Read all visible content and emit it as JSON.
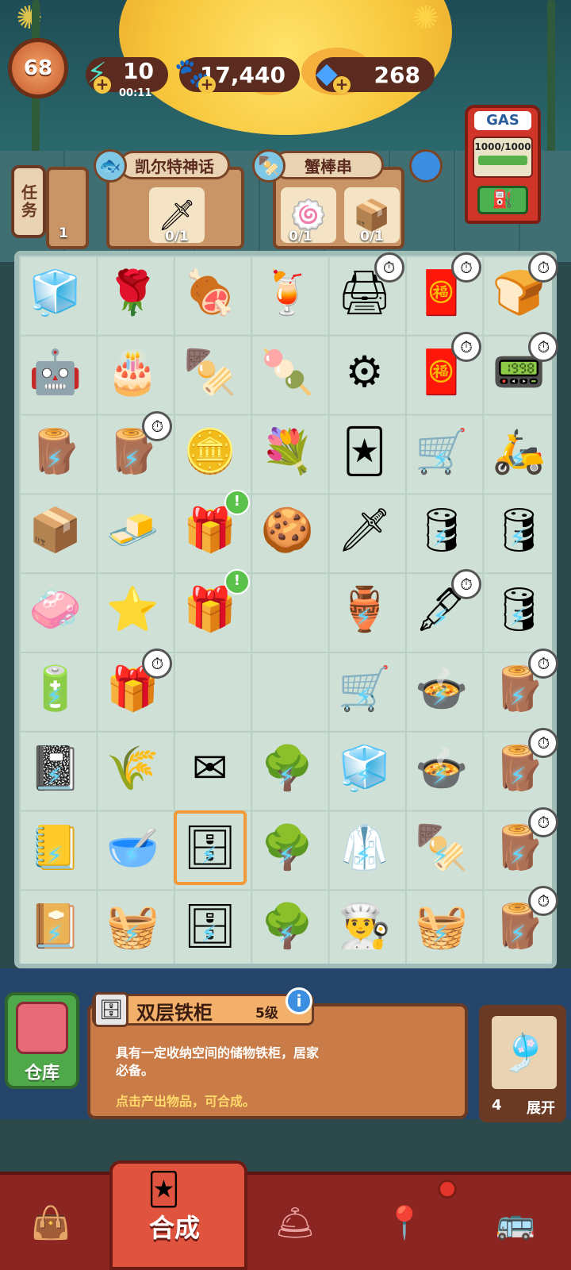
{
  "header": {
    "level": "68",
    "energy": {
      "value": "10",
      "timer": "00:11"
    },
    "coins": "17,440",
    "gems": "268"
  },
  "gas_pump": {
    "label": "GAS",
    "value": "1000/1000"
  },
  "tasks": {
    "label": "任务"
  },
  "orders": [
    {
      "title": "",
      "count": "1"
    },
    {
      "title": "凯尔特神话",
      "items": [
        {
          "icon": "sword-ice-icon",
          "count": "0/1"
        }
      ]
    },
    {
      "title": "蟹棒串",
      "items": [
        {
          "icon": "cake-roll-icon",
          "count": "0/1"
        },
        {
          "icon": "takeout-box-icon",
          "count": "0/1"
        }
      ]
    }
  ],
  "board": {
    "rows": [
      [
        "blue-ice-icon",
        "rose-bouquet-icon",
        "meat-plate-icon",
        "cocktail-cup-icon",
        "printer-icon",
        "red-envelope-icon",
        "toaster-icon"
      ],
      [
        "robot-armor-icon",
        "birthday-cake-icon",
        "skewer-plate-icon",
        "meat-ball-icon",
        "blue-machine-icon",
        "red-envelope-box-icon",
        "microwave-icon"
      ],
      [
        "log-icon",
        "log-pile-icon",
        "paw-coins-icon",
        "roses-icon",
        "card-deck-icon",
        "hand-truck-icon",
        "delivery-scooter-icon"
      ],
      [
        "small-crate-icon",
        "gold-bars-icon",
        "gift-box-icon",
        "cookie-icon",
        "sword-display-icon",
        "barrel-icon",
        "iron-barrel-icon"
      ],
      [
        "soap-bar-icon",
        "star-cookie-icon",
        "gift-box-icon",
        "",
        "flower-vase-icon",
        "fountain-pen-icon",
        "green-barrel-icon"
      ],
      [
        "battery-icon",
        "gift-box-icon",
        "",
        "",
        "food-cart-icon",
        "cooking-pot-icon",
        "log-bundle-icon"
      ],
      [
        "notebook-icon",
        "grain-sack-icon",
        "envelope-icon",
        "tree-icon",
        "fridge-icon",
        "stew-pot-icon",
        "log-bundle-icon"
      ],
      [
        "spiral-notebook-icon",
        "soup-bowl-icon",
        "iron-cabinet-icon",
        "tree-icon",
        "chef-coat-icon",
        "skewer-pot-icon",
        "log-bundle-icon"
      ],
      [
        "photo-album-icon",
        "ribbon-basket-icon",
        "open-cabinet-icon",
        "tree-icon",
        "chef-hat-icon",
        "food-basket-icon",
        "log-bundle-icon"
      ]
    ],
    "selected": "iron-cabinet-icon"
  },
  "item_info": {
    "name": "双层铁柜",
    "level": "5级",
    "description": "具有一定收纳空间的储物铁柜，居家必备。",
    "hint": "点击产出物品，可合成。"
  },
  "storage": {
    "label": "仓库"
  },
  "side_panel": {
    "count": "4",
    "expand": "展开"
  },
  "nav": {
    "items": [
      "shop-bag-icon",
      "merge-icon",
      "restaurant-icon",
      "map-pin-icon",
      "bus-icon"
    ],
    "active_label": "合成"
  },
  "colors": {
    "nav_bg": "#8a2522",
    "active_tab": "#e0533f",
    "board": "#cfe0d6"
  }
}
